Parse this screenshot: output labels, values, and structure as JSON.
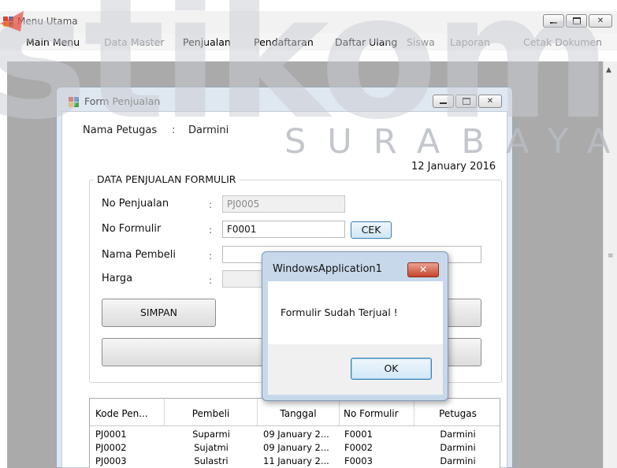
{
  "main_window": {
    "title": "Menu Utama",
    "menu": [
      {
        "label": "Main Menu",
        "enabled": true
      },
      {
        "label": "Data Master",
        "enabled": false
      },
      {
        "label": "Penjualan",
        "enabled": true
      },
      {
        "label": "Pendaftaran",
        "enabled": true
      },
      {
        "label": "Daftar Ulang",
        "enabled": true
      },
      {
        "label": "Siswa",
        "enabled": false
      },
      {
        "label": "Laporan",
        "enabled": false
      },
      {
        "label": "Cetak Dokumen",
        "enabled": false
      }
    ]
  },
  "form": {
    "title": "Form Penjualan",
    "petugas_label": "Nama Petugas",
    "colon": ":",
    "petugas_value": "Darmini",
    "date": "12 January 2016",
    "group_title": "DATA PENJUALAN FORMULIR",
    "fields": {
      "no_penjualan": {
        "label": "No Penjualan",
        "value": "PJ0005"
      },
      "no_formulir": {
        "label": "No Formulir",
        "value": "F0001"
      },
      "nama_pembeli": {
        "label": "Nama Pembeli",
        "value": ""
      },
      "harga": {
        "label": "Harga",
        "value": ""
      }
    },
    "cek_button": "CEK",
    "simpan_button": "SIMPAN",
    "grid": {
      "columns": [
        "Kode Pen...",
        "Pembeli",
        "Tanggal",
        "No Formulir",
        "Petugas"
      ],
      "rows": [
        [
          "PJ0001",
          "Suparmi",
          "09 January 2...",
          "F0001",
          "Darmini"
        ],
        [
          "PJ0002",
          "Sujatmi",
          "09 January 2...",
          "F0002",
          "Darmini"
        ],
        [
          "PJ0003",
          "Sulastri",
          "11 January 2...",
          "F0003",
          "Darmini"
        ]
      ]
    }
  },
  "message_box": {
    "title": "WindowsApplication1",
    "close_glyph": "✕",
    "text": "Formulir Sudah Terjual !",
    "ok_button": "OK"
  },
  "watermark": {
    "word": "stikom",
    "sub": "SURABAYA",
    "colors": {
      "red": "#e74a3b",
      "grey": "#b7bbc1"
    }
  },
  "colors": {
    "mdi_background": "#aaaaaa",
    "form_frame": "#dfe7f1",
    "msgbox_frame": "#c7d8ea",
    "close_red": "#c7442b"
  }
}
